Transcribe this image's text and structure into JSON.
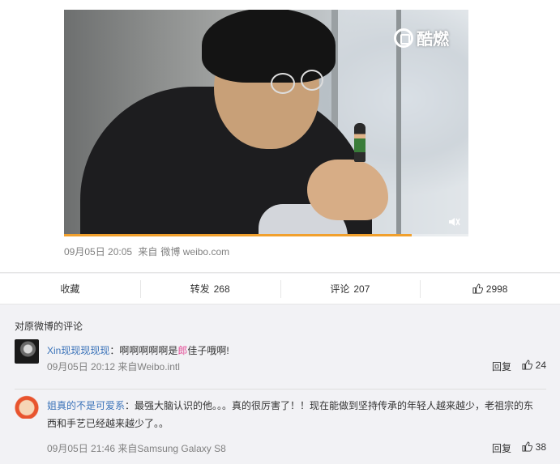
{
  "video": {
    "watermark": "酷燃",
    "progress": 0.86
  },
  "post": {
    "date": "09月05日 20:05",
    "source_prefix": "来自",
    "source": "微博 weibo.com"
  },
  "actions": {
    "favorite": "收藏",
    "repost_label": "转发",
    "repost_count": "268",
    "comment_label": "评论",
    "comment_count": "207",
    "like_count": "2998"
  },
  "comments": {
    "title": "对原微博的评论",
    "reply_label": "回复",
    "items": [
      {
        "user": "Xin现现现现现",
        "text_before": "：啊啊啊啊啊是",
        "text_highlight": "郎",
        "text_after": "佳子哦啊!",
        "meta": "09月05日 20:12 来自Weibo.intl",
        "likes": "24"
      },
      {
        "user": "姐真的不是可爱系",
        "text": "：最强大脑认识的他。。。真的很厉害了！！现在能做到坚持传承的年轻人越来越少，老祖宗的东西和手艺已经越来越少了。。",
        "meta": "09月05日 21:46 来自Samsung Galaxy S8",
        "likes": "38"
      }
    ]
  }
}
